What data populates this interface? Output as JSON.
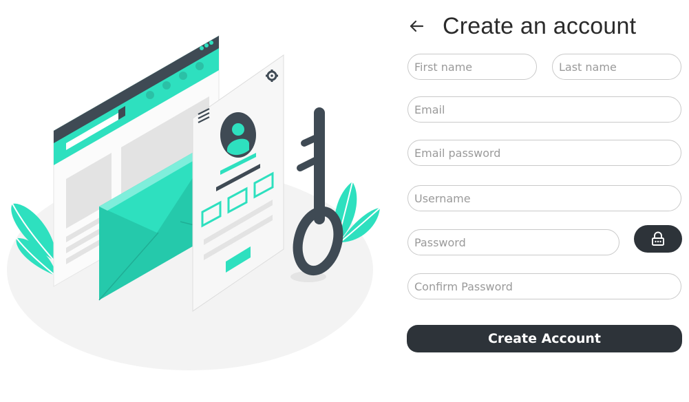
{
  "header": {
    "title": "Create an account",
    "back_icon": "arrow-left-icon"
  },
  "form": {
    "first_name": {
      "placeholder": "First name",
      "value": ""
    },
    "last_name": {
      "placeholder": "Last name",
      "value": ""
    },
    "email": {
      "placeholder": "Email",
      "value": ""
    },
    "email_password": {
      "placeholder": "Email password",
      "value": ""
    },
    "username": {
      "placeholder": "Username",
      "value": ""
    },
    "password": {
      "placeholder": "Password",
      "value": ""
    },
    "confirm_password": {
      "placeholder": "Confirm Password",
      "value": ""
    },
    "password_toggle_icon": "lock-icon",
    "submit_label": "Create Account"
  },
  "colors": {
    "accent": "#2ee0bf",
    "dark": "#2d3339",
    "illustration_dark": "#3f4a54"
  }
}
